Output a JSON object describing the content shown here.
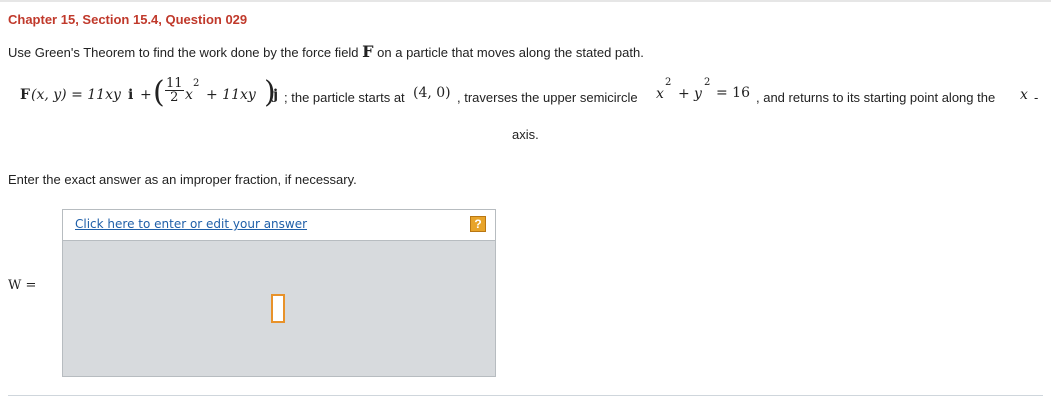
{
  "heading": "Chapter 15, Section 15.4, Question 029",
  "instruction": {
    "before": "Use Green's Theorem to find the work done by the force field",
    "symbol": "F",
    "after": "on a particle that moves along the stated path."
  },
  "problem": {
    "lhs": "F",
    "lhs_args": "(x, y) = 11xy",
    "i": "i",
    "plus": "+",
    "frac_num": "11",
    "frac_den": "2",
    "x2": "x",
    "exp2": "2",
    "plus_term": "+ 11xy",
    "j": "j",
    "text1": "; the particle starts at",
    "point": "(4, 0)",
    "text2": ", traverses the upper semicircle",
    "circle_x": "x",
    "circle_plus": "+",
    "circle_y": "y",
    "circle_rhs": "= 16",
    "text3": ", and returns to its starting point along the",
    "axis_var": "x",
    "dash": "-",
    "axis_word": "axis."
  },
  "enter_note": "Enter the exact answer as an improper fraction, if necessary.",
  "answer": {
    "link_text": "Click here to enter or edit your answer",
    "help_icon": "?",
    "w_label": "W =",
    "value": ""
  }
}
